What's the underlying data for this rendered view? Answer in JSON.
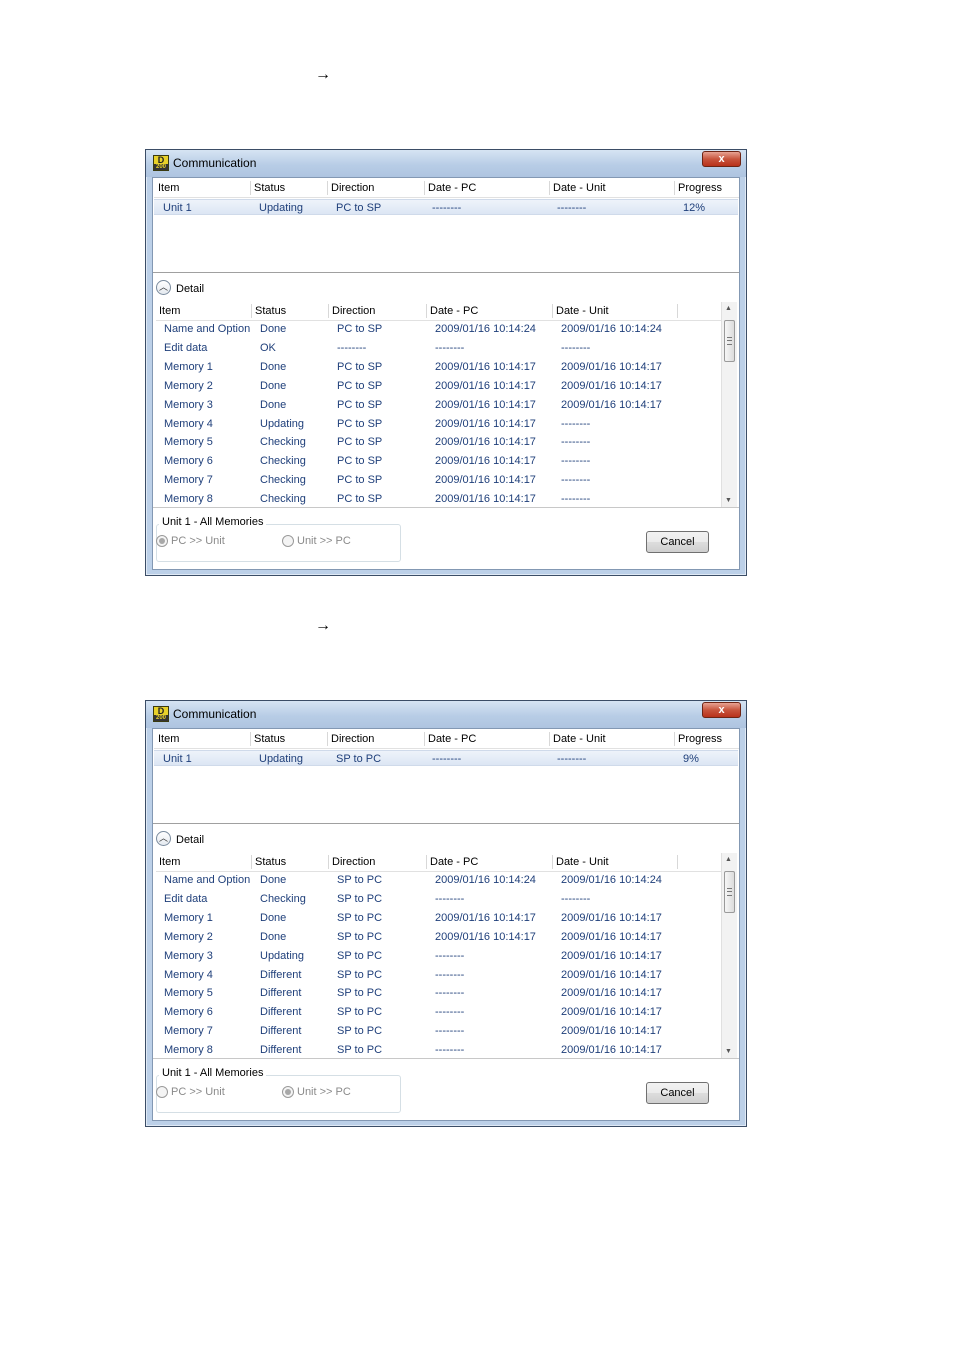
{
  "arrows": [
    "→",
    "→"
  ],
  "windows": [
    {
      "title": "Communication",
      "close_label": "x",
      "top_columns": [
        "Item",
        "Status",
        "Direction",
        "Date - PC",
        "Date - Unit",
        "Progress"
      ],
      "top_row": {
        "item": "Unit 1",
        "status": "Updating",
        "direction": "PC to SP",
        "date_pc": "--------",
        "date_unit": "--------",
        "progress": "12%"
      },
      "detail_label": "Detail",
      "detail_columns": [
        "Item",
        "Status",
        "Direction",
        "Date - PC",
        "Date - Unit"
      ],
      "detail_rows": [
        {
          "item": "Name and Option",
          "status": "Done",
          "direction": "PC to SP",
          "date_pc": "2009/01/16 10:14:24",
          "date_unit": "2009/01/16 10:14:24"
        },
        {
          "item": "Edit data",
          "status": "OK",
          "direction": "--------",
          "date_pc": "--------",
          "date_unit": "--------"
        },
        {
          "item": "Memory 1",
          "status": "Done",
          "direction": "PC to SP",
          "date_pc": "2009/01/16 10:14:17",
          "date_unit": "2009/01/16 10:14:17"
        },
        {
          "item": "Memory 2",
          "status": "Done",
          "direction": "PC to SP",
          "date_pc": "2009/01/16 10:14:17",
          "date_unit": "2009/01/16 10:14:17"
        },
        {
          "item": "Memory 3",
          "status": "Done",
          "direction": "PC to SP",
          "date_pc": "2009/01/16 10:14:17",
          "date_unit": "2009/01/16 10:14:17"
        },
        {
          "item": "Memory 4",
          "status": "Updating",
          "direction": "PC to SP",
          "date_pc": "2009/01/16 10:14:17",
          "date_unit": "--------"
        },
        {
          "item": "Memory 5",
          "status": "Checking",
          "direction": "PC to SP",
          "date_pc": "2009/01/16 10:14:17",
          "date_unit": "--------"
        },
        {
          "item": "Memory 6",
          "status": "Checking",
          "direction": "PC to SP",
          "date_pc": "2009/01/16 10:14:17",
          "date_unit": "--------"
        },
        {
          "item": "Memory 7",
          "status": "Checking",
          "direction": "PC to SP",
          "date_pc": "2009/01/16 10:14:17",
          "date_unit": "--------"
        },
        {
          "item": "Memory 8",
          "status": "Checking",
          "direction": "PC to SP",
          "date_pc": "2009/01/16 10:14:17",
          "date_unit": "--------"
        }
      ],
      "group_title": "Unit 1 - All Memories",
      "radio_a": {
        "label": "PC >> Unit",
        "selected": true
      },
      "radio_b": {
        "label": "Unit >> PC",
        "selected": false
      },
      "cancel_label": "Cancel"
    },
    {
      "title": "Communication",
      "close_label": "x",
      "top_columns": [
        "Item",
        "Status",
        "Direction",
        "Date - PC",
        "Date - Unit",
        "Progress"
      ],
      "top_row": {
        "item": "Unit 1",
        "status": "Updating",
        "direction": "SP to PC",
        "date_pc": "--------",
        "date_unit": "--------",
        "progress": "9%"
      },
      "detail_label": "Detail",
      "detail_columns": [
        "Item",
        "Status",
        "Direction",
        "Date - PC",
        "Date - Unit"
      ],
      "detail_rows": [
        {
          "item": "Name and Option",
          "status": "Done",
          "direction": "SP to PC",
          "date_pc": "2009/01/16 10:14:24",
          "date_unit": "2009/01/16 10:14:24"
        },
        {
          "item": "Edit data",
          "status": "Checking",
          "direction": "SP to PC",
          "date_pc": "--------",
          "date_unit": "--------"
        },
        {
          "item": "Memory 1",
          "status": "Done",
          "direction": "SP to PC",
          "date_pc": "2009/01/16 10:14:17",
          "date_unit": "2009/01/16 10:14:17"
        },
        {
          "item": "Memory 2",
          "status": "Done",
          "direction": "SP to PC",
          "date_pc": "2009/01/16 10:14:17",
          "date_unit": "2009/01/16 10:14:17"
        },
        {
          "item": "Memory 3",
          "status": "Updating",
          "direction": "SP to PC",
          "date_pc": "--------",
          "date_unit": "2009/01/16 10:14:17"
        },
        {
          "item": "Memory 4",
          "status": "Different",
          "direction": "SP to PC",
          "date_pc": "--------",
          "date_unit": "2009/01/16 10:14:17"
        },
        {
          "item": "Memory 5",
          "status": "Different",
          "direction": "SP to PC",
          "date_pc": "--------",
          "date_unit": "2009/01/16 10:14:17"
        },
        {
          "item": "Memory 6",
          "status": "Different",
          "direction": "SP to PC",
          "date_pc": "--------",
          "date_unit": "2009/01/16 10:14:17"
        },
        {
          "item": "Memory 7",
          "status": "Different",
          "direction": "SP to PC",
          "date_pc": "--------",
          "date_unit": "2009/01/16 10:14:17"
        },
        {
          "item": "Memory 8",
          "status": "Different",
          "direction": "SP to PC",
          "date_pc": "--------",
          "date_unit": "2009/01/16 10:14:17"
        }
      ],
      "group_title": "Unit 1 - All Memories",
      "radio_a": {
        "label": "PC >> Unit",
        "selected": false
      },
      "radio_b": {
        "label": "Unit >> PC",
        "selected": true
      },
      "cancel_label": "Cancel"
    }
  ]
}
